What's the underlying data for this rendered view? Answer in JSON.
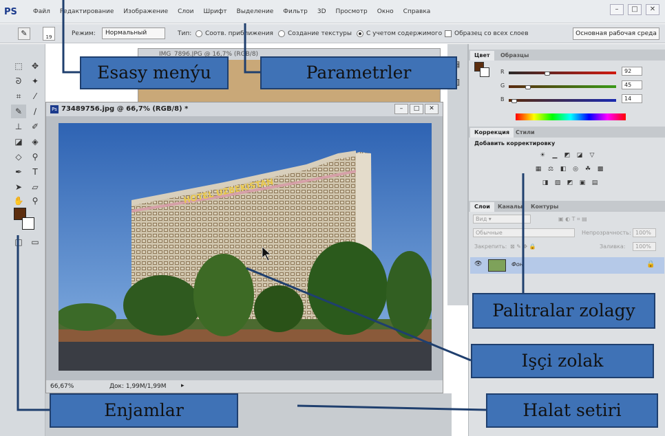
{
  "menubar": {
    "logo": "PS",
    "items": [
      "Файл",
      "Редактирование",
      "Изображение",
      "Слои",
      "Шрифт",
      "Выделение",
      "Фильтр",
      "3D",
      "Просмотр",
      "Окно",
      "Справка"
    ],
    "window_controls": [
      "–",
      "□",
      "✕"
    ]
  },
  "options": {
    "brush_size": "19",
    "mode_label": "Режим:",
    "mode_value": "Нормальный",
    "type_label": "Тип:",
    "type_opt1": "Соотв. приближения",
    "type_opt2": "Создание текстуры",
    "type_opt3": "С учетом содержимого",
    "sample_all": "Образец со всех слоев",
    "workspace": "Основная рабочая среда"
  },
  "bg_document": {
    "title": "IMG_7896.JPG @ 16,7% (RGB/8)"
  },
  "document": {
    "title": "73489756.jpg @ 66,7% (RGB/8) *",
    "controls": [
      "–",
      "□",
      "✕"
    ],
    "zoom": "66,67%",
    "doc_size": "Док: 1,99M/1,99M",
    "hotel_sign": "HOTEL UZBEKISTAN"
  },
  "colors": {
    "tabs": [
      "Цвет",
      "Образцы"
    ],
    "r_label": "R",
    "r_value": "92",
    "g_label": "G",
    "g_value": "45",
    "b_label": "B",
    "b_value": "14",
    "r_level": 0.36,
    "g_level": 0.18,
    "b_level": 0.05,
    "foreground": "#5c2d0e"
  },
  "adjustments": {
    "tabs": [
      "Коррекция",
      "Стили"
    ],
    "title": "Добавить корректировку"
  },
  "layers": {
    "tabs": [
      "Слои",
      "Каналы",
      "Контуры"
    ],
    "kind_filter": "Вид",
    "blend_mode": "Обычные",
    "opacity_label": "Непрозрачность:",
    "opacity_value": "100%",
    "lock_label": "Закрепить:",
    "fill_label": "Заливка:",
    "fill_value": "100%",
    "layer_name": "Фон"
  },
  "callouts": {
    "menu": "Esasy menýu",
    "options": "Parametrler",
    "panels": "Palitralar zolagy",
    "canvas": "Işçi zolak",
    "tools": "Enjamlar",
    "status": "Halat setiri"
  }
}
